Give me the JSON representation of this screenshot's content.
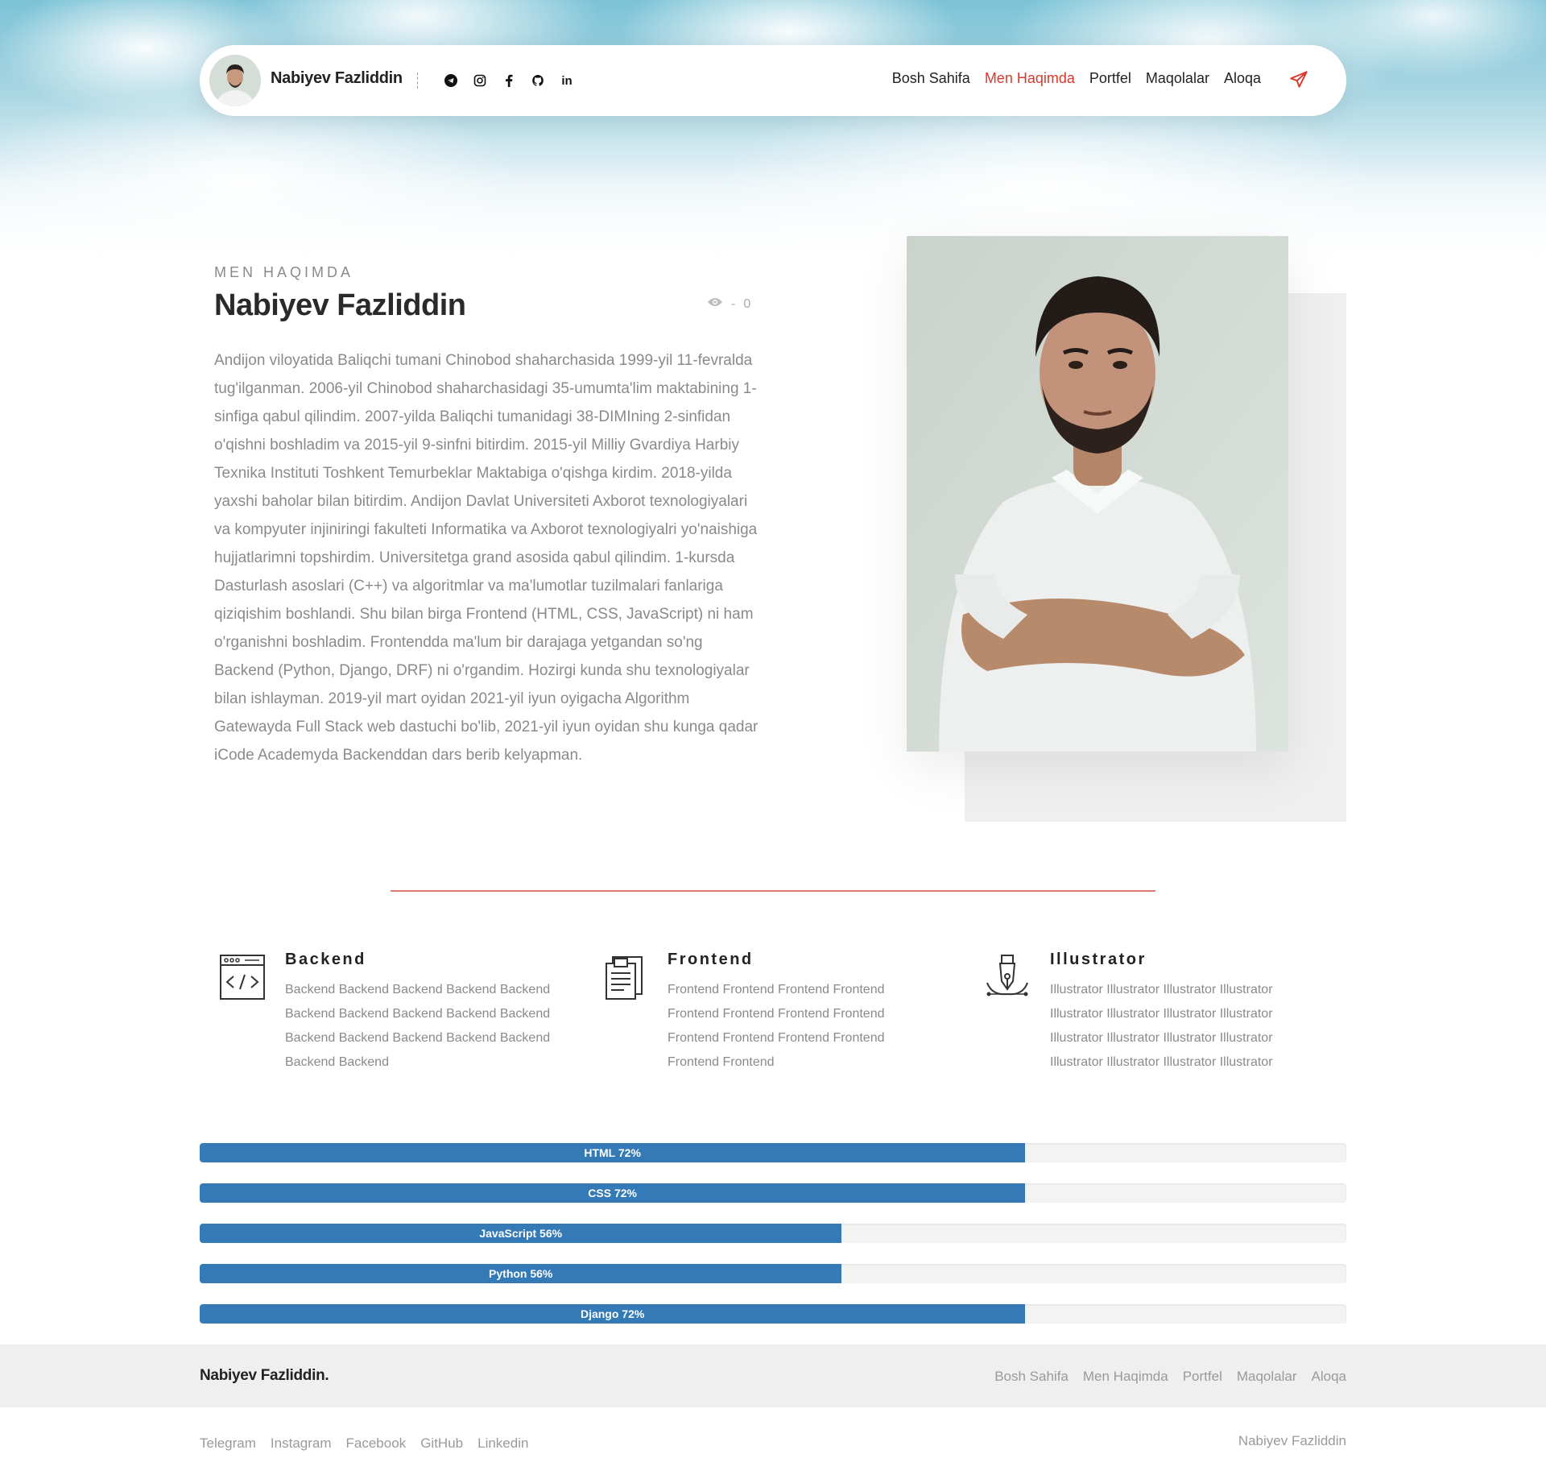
{
  "header": {
    "name": "Nabiyev Fazliddin",
    "socials": [
      {
        "icon": "telegram-icon"
      },
      {
        "icon": "instagram-icon"
      },
      {
        "icon": "facebook-icon"
      },
      {
        "icon": "github-icon"
      },
      {
        "icon": "linkedin-icon"
      }
    ],
    "menu": [
      "Bosh Sahifa",
      "Men Haqimda",
      "Portfel",
      "Maqolalar",
      "Aloqa"
    ],
    "active_menu": "Men Haqimda",
    "send_icon": "send-icon"
  },
  "about": {
    "eyebrow": "MEN HAQIMDA",
    "title": "Nabiyev Fazliddin",
    "views_separator": "-",
    "views_count": "0",
    "bio": "Andijon viloyatida Baliqchi tumani Chinobod shaharchasida 1999-yil 11-fevralda tug'ilganman. 2006-yil Chinobod shaharchasidagi 35-umumta'lim maktabining 1-sinfiga qabul qilindim. 2007-yilda Baliqchi tumanidagi 38-DIMIning 2-sinfidan o'qishni boshladim va 2015-yil 9-sinfni bitirdim. 2015-yil Milliy Gvardiya Harbiy Texnika Instituti Toshkent Temurbeklar Maktabiga o'qishga kirdim. 2018-yilda yaxshi baholar bilan bitirdim. Andijon Davlat Universiteti Axborot texnologiyalari va kompyuter injiniringi fakulteti Informatika va Axborot texnologiyalri yo'naishiga hujjatlarimni topshirdim. Universitetga grand asosida qabul qilindim. 1-kursda Dasturlash asoslari (C++) va algoritmlar va ma'lumotlar tuzilmalari fanlariga qiziqishim boshlandi. Shu bilan birga Frontend (HTML, CSS, JavaScript) ni ham o'rganishni boshladim. Frontendda ma'lum bir darajaga yetgandan so'ng Backend (Python, Django, DRF) ni o'rgandim. Hozirgi kunda shu texnologiyalar bilan ishlayman. 2019-yil mart oyidan 2021-yil iyun oyigacha Algorithm Gatewayda Full Stack web dastuchi bo'lib, 2021-yil iyun oyidan shu kunga qadar iCode Academyda Backenddan dars berib kelyapman."
  },
  "services": [
    {
      "title": "Backend",
      "icon": "code-window-icon",
      "text": "Backend Backend Backend Backend Backend Backend Backend Backend Backend Backend Backend Backend Backend Backend Backend Backend Backend"
    },
    {
      "title": "Frontend",
      "icon": "documents-icon",
      "text": "Frontend Frontend Frontend Frontend Frontend Frontend Frontend Frontend Frontend Frontend Frontend Frontend Frontend Frontend"
    },
    {
      "title": "Illustrator",
      "icon": "pen-tool-icon",
      "text": "Illustrator Illustrator Illustrator Illustrator Illustrator Illustrator Illustrator Illustrator Illustrator Illustrator Illustrator Illustrator Illustrator Illustrator Illustrator Illustrator"
    }
  ],
  "skills": [
    {
      "label": "HTML 72%",
      "percent": 72
    },
    {
      "label": "CSS 72%",
      "percent": 72
    },
    {
      "label": "JavaScript 56%",
      "percent": 56
    },
    {
      "label": "Python 56%",
      "percent": 56
    },
    {
      "label": "Django 72%",
      "percent": 72
    }
  ],
  "footer": {
    "brand": "Nabiyev Fazliddin.",
    "menu": [
      "Bosh Sahifa",
      "Men Haqimda",
      "Portfel",
      "Maqolalar",
      "Aloqa"
    ],
    "socials": [
      "Telegram",
      "Instagram",
      "Facebook",
      "GitHub",
      "Linkedin"
    ],
    "copyright": "Nabiyev Fazliddin"
  },
  "colors": {
    "accent": "#d9372a",
    "progress": "#337ab7",
    "sky": "#7cc3d6"
  }
}
